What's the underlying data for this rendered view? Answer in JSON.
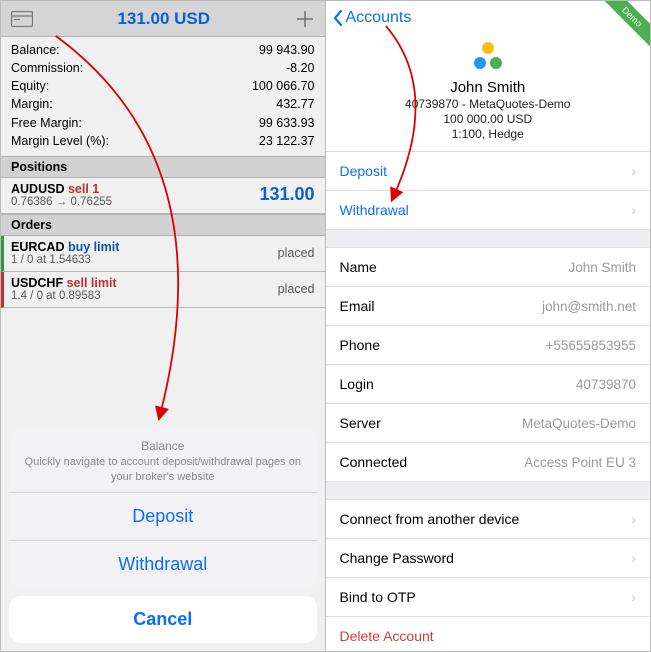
{
  "left": {
    "header_amount": "131.00 USD",
    "metrics": [
      {
        "label": "Balance:",
        "value": "99 943.90"
      },
      {
        "label": "Commission:",
        "value": "-8.20"
      },
      {
        "label": "Equity:",
        "value": "100 066.70"
      },
      {
        "label": "Margin:",
        "value": "432.77"
      },
      {
        "label": "Free Margin:",
        "value": "99 633.93"
      },
      {
        "label": "Margin Level (%):",
        "value": "23 122.37"
      }
    ],
    "positions_header": "Positions",
    "position": {
      "symbol": "AUDUSD",
      "side": "sell 1",
      "range": "0.76386 → 0.76255",
      "pnl": "131.00"
    },
    "orders_header": "Orders",
    "orders": [
      {
        "symbol": "EURCAD",
        "side": "buy limit",
        "detail": "1 / 0 at 1.54633",
        "status": "placed"
      },
      {
        "symbol": "USDCHF",
        "side": "sell limit",
        "detail": "1.4 / 0 at 0.89583",
        "status": "placed"
      }
    ],
    "sheet": {
      "title": "Balance",
      "desc": "Quickly navigate to account deposit/withdrawal pages on your broker's website",
      "deposit": "Deposit",
      "withdrawal": "Withdrawal",
      "cancel": "Cancel"
    }
  },
  "right": {
    "back": "Accounts",
    "demo_badge": "Demo",
    "profile": {
      "name": "John Smith",
      "login_server": "40739870 - MetaQuotes-Demo",
      "balance": "100 000.00 USD",
      "leverage": "1:100, Hedge"
    },
    "money": {
      "deposit": "Deposit",
      "withdrawal": "Withdrawal"
    },
    "info": {
      "name_label": "Name",
      "name_value": "John Smith",
      "email_label": "Email",
      "email_value": "john@smith.net",
      "phone_label": "Phone",
      "phone_value": "+55655853955",
      "login_label": "Login",
      "login_value": "40739870",
      "server_label": "Server",
      "server_value": "MetaQuotes-Demo",
      "connected_label": "Connected",
      "connected_value": "Access Point EU 3"
    },
    "actions": {
      "connect": "Connect from another device",
      "change_pw": "Change Password",
      "bind_otp": "Bind to OTP",
      "delete": "Delete Account"
    }
  }
}
